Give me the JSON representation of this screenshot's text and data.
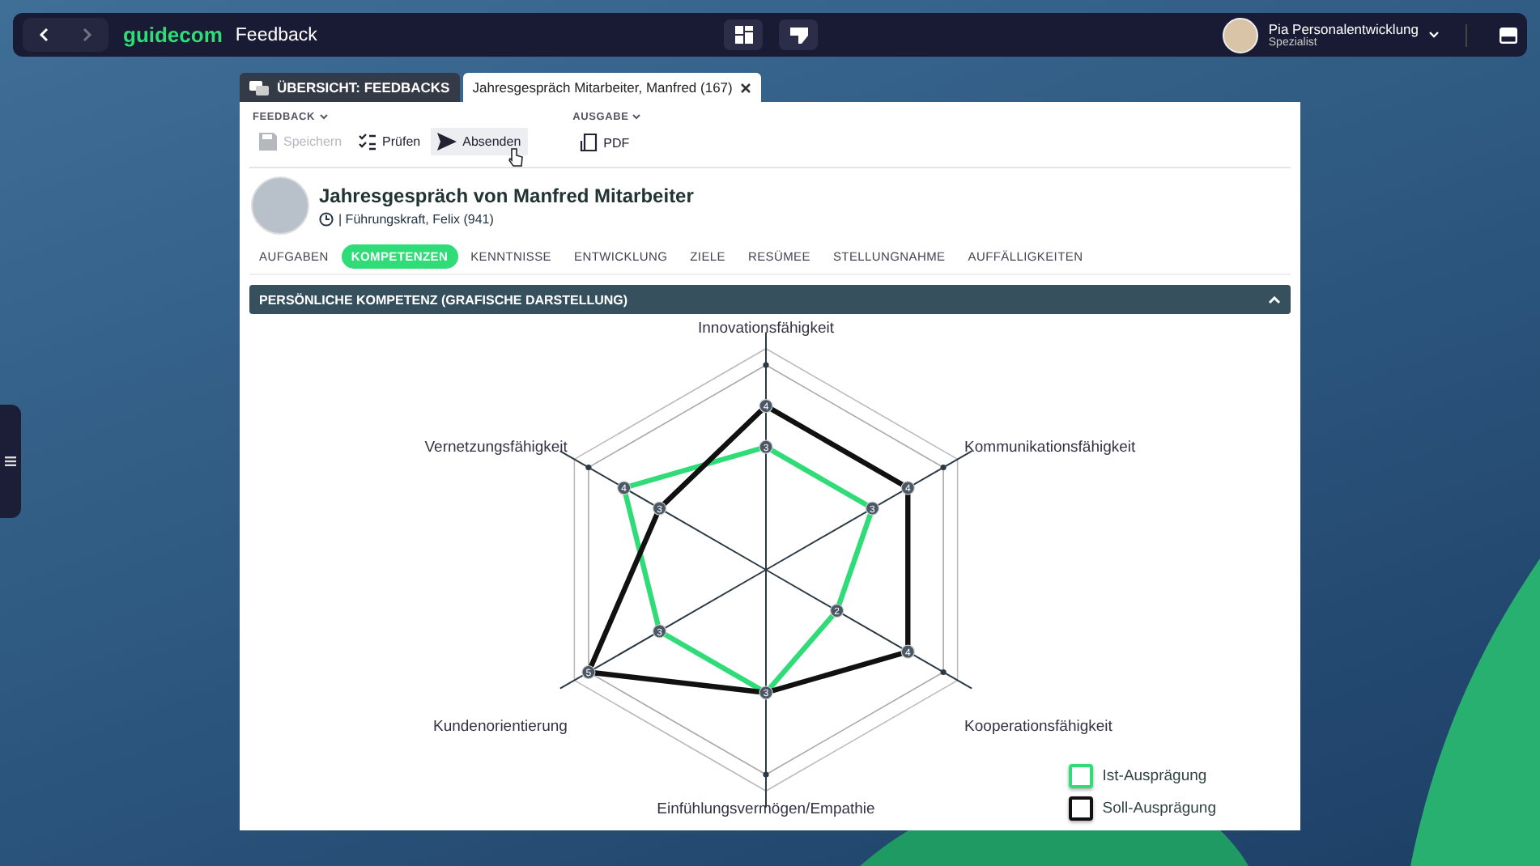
{
  "top_bar": {
    "logo": "guidecom",
    "title": "Feedback",
    "user": {
      "name": "Pia Personalentwicklung",
      "role": "Spezialist"
    }
  },
  "doc_tabs": [
    {
      "label": "ÜBERSICHT: FEEDBACKS",
      "selected": false,
      "closable": false
    },
    {
      "label": "Jahresgespräch Mitarbeiter, Manfred (167)",
      "selected": true,
      "closable": true
    }
  ],
  "toolbar": {
    "groups": [
      {
        "label": "FEEDBACK",
        "buttons": [
          {
            "kind": "save",
            "label": "Speichern",
            "disabled": true,
            "hovered": false
          },
          {
            "kind": "check",
            "label": "Prüfen",
            "disabled": false,
            "hovered": false
          },
          {
            "kind": "send",
            "label": "Absenden",
            "disabled": false,
            "hovered": true
          }
        ]
      },
      {
        "label": "AUSGABE",
        "buttons": [
          {
            "kind": "pdf",
            "label": "PDF",
            "disabled": false,
            "hovered": false
          }
        ]
      }
    ]
  },
  "header": {
    "title": "Jahresgespräch von Manfred Mitarbeiter",
    "subtitle": "| Führungskraft, Felix (941)"
  },
  "nav_tabs": [
    {
      "label": "AUFGABEN",
      "selected": false
    },
    {
      "label": "KOMPETENZEN",
      "selected": true
    },
    {
      "label": "KENNTNISSE",
      "selected": false
    },
    {
      "label": "ENTWICKLUNG",
      "selected": false
    },
    {
      "label": "ZIELE",
      "selected": false
    },
    {
      "label": "RESÜMEE",
      "selected": false
    },
    {
      "label": "STELLUNGNAHME",
      "selected": false
    },
    {
      "label": "AUFFÄLLIGKEITEN",
      "selected": false
    }
  ],
  "section": {
    "title": "PERSÖNLICHE KOMPETENZ (GRAFISCHE DARSTELLUNG)",
    "expanded": true,
    "radar": {
      "series": [
        {
          "kind": "actual",
          "name": "Ist-Ausprägung",
          "color": "#2fdc78"
        },
        {
          "kind": "target",
          "name": "Soll-Ausprägung",
          "color": "#111111"
        }
      ],
      "axes": [
        {
          "label": "Innovationsfähigkeit",
          "points": [
            {
              "kind": "target",
              "value": "4"
            },
            {
              "kind": "actual",
              "value": "3"
            }
          ]
        },
        {
          "label": "Vernetzungsfähigkeit",
          "points": [
            {
              "kind": "actual",
              "value": "4"
            },
            {
              "kind": "target",
              "value": "3"
            }
          ]
        },
        {
          "label": "Kommunikationsfähigkeit",
          "points": [
            {
              "kind": "target",
              "value": "4"
            },
            {
              "kind": "actual",
              "value": "3"
            }
          ]
        },
        {
          "label": "Kundenorientierung",
          "points": [
            {
              "kind": "actual",
              "value": "3"
            },
            {
              "kind": "target",
              "value": "5"
            }
          ]
        },
        {
          "label": "Kooperationsfähigkeit",
          "points": [
            {
              "kind": "actual",
              "value": "2"
            },
            {
              "kind": "target",
              "value": "4"
            }
          ]
        },
        {
          "label": "Einfühlungsvermögen/Empathie",
          "points": [
            {
              "kind": "both",
              "value": "3"
            }
          ]
        }
      ]
    }
  }
}
